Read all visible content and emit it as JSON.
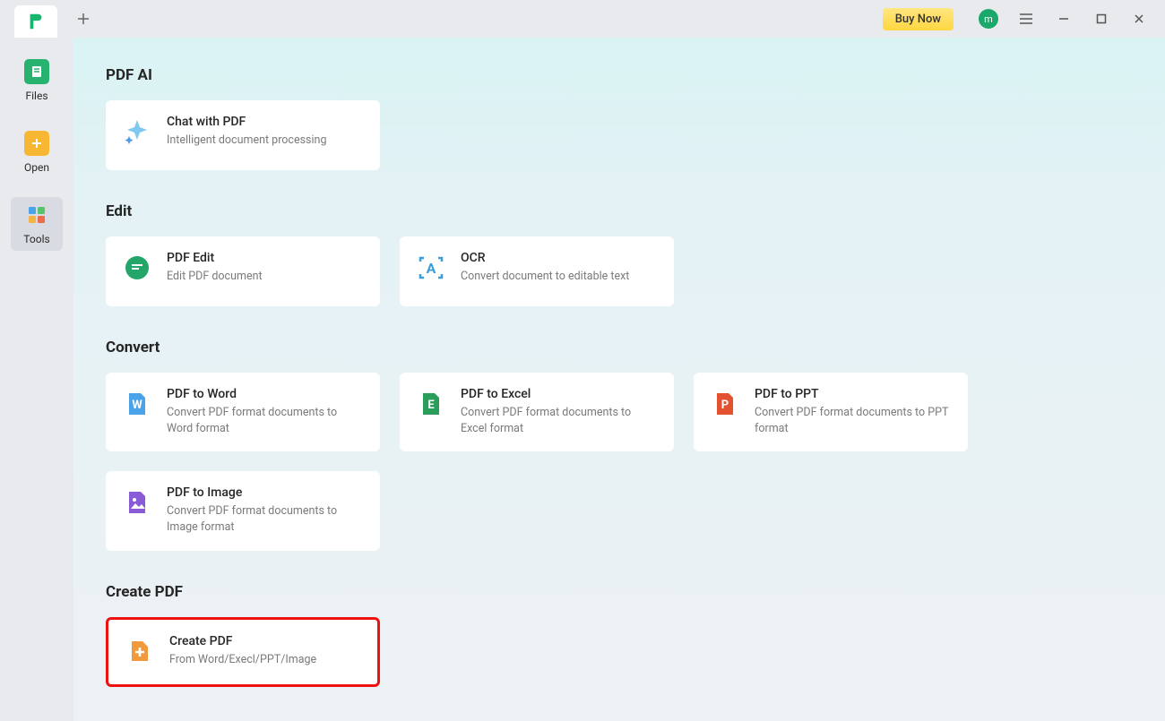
{
  "titlebar": {
    "buy_now": "Buy Now",
    "avatar_letter": "m"
  },
  "sidebar": {
    "items": [
      {
        "label": "Files"
      },
      {
        "label": "Open"
      },
      {
        "label": "Tools"
      }
    ]
  },
  "sections": {
    "pdf_ai": {
      "title": "PDF AI",
      "cards": [
        {
          "title": "Chat with PDF",
          "desc": "Intelligent document processing"
        }
      ]
    },
    "edit": {
      "title": "Edit",
      "cards": [
        {
          "title": "PDF Edit",
          "desc": "Edit PDF document"
        },
        {
          "title": "OCR",
          "desc": "Convert document to editable text"
        }
      ]
    },
    "convert": {
      "title": "Convert",
      "cards": [
        {
          "title": "PDF to Word",
          "desc": "Convert PDF format documents to Word format"
        },
        {
          "title": "PDF to Excel",
          "desc": "Convert PDF format documents to Excel format"
        },
        {
          "title": "PDF to PPT",
          "desc": "Convert PDF format documents to PPT format"
        },
        {
          "title": "PDF to Image",
          "desc": "Convert PDF format documents to Image format"
        }
      ]
    },
    "create": {
      "title": "Create PDF",
      "cards": [
        {
          "title": "Create PDF",
          "desc": "From Word/Execl/PPT/Image"
        }
      ]
    }
  }
}
